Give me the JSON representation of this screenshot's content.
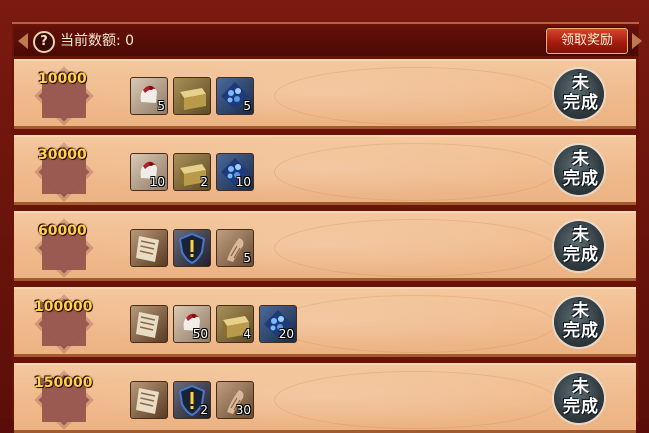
{
  "header": {
    "quota_label": "当前数额: ",
    "quota_value": "0",
    "claim_button": "领取奖励"
  },
  "rows": [
    {
      "amount": "10000",
      "status_line1": "未",
      "status_line2": "完成",
      "items": [
        {
          "icon": "glove-icon",
          "qty": "5"
        },
        {
          "icon": "chest-icon",
          "qty": ""
        },
        {
          "icon": "gem-icon",
          "qty": "5"
        }
      ]
    },
    {
      "amount": "30000",
      "status_line1": "未",
      "status_line2": "完成",
      "items": [
        {
          "icon": "glove-icon",
          "qty": "10"
        },
        {
          "icon": "chest-icon",
          "qty": "2"
        },
        {
          "icon": "gem-icon",
          "qty": "10"
        }
      ]
    },
    {
      "amount": "60000",
      "status_line1": "未",
      "status_line2": "完成",
      "items": [
        {
          "icon": "book-icon",
          "qty": ""
        },
        {
          "icon": "shield-icon",
          "qty": ""
        },
        {
          "icon": "scroll-icon",
          "qty": "5"
        }
      ]
    },
    {
      "amount": "100000",
      "status_line1": "未",
      "status_line2": "完成",
      "items": [
        {
          "icon": "book-icon",
          "qty": ""
        },
        {
          "icon": "glove-icon",
          "qty": "50"
        },
        {
          "icon": "chest-icon",
          "qty": "4"
        },
        {
          "icon": "gem-icon",
          "qty": "20"
        }
      ]
    },
    {
      "amount": "150000",
      "status_line1": "未",
      "status_line2": "完成",
      "items": [
        {
          "icon": "book-icon",
          "qty": ""
        },
        {
          "icon": "shield-icon",
          "qty": "2"
        },
        {
          "icon": "scroll-icon",
          "qty": "30"
        }
      ]
    }
  ]
}
